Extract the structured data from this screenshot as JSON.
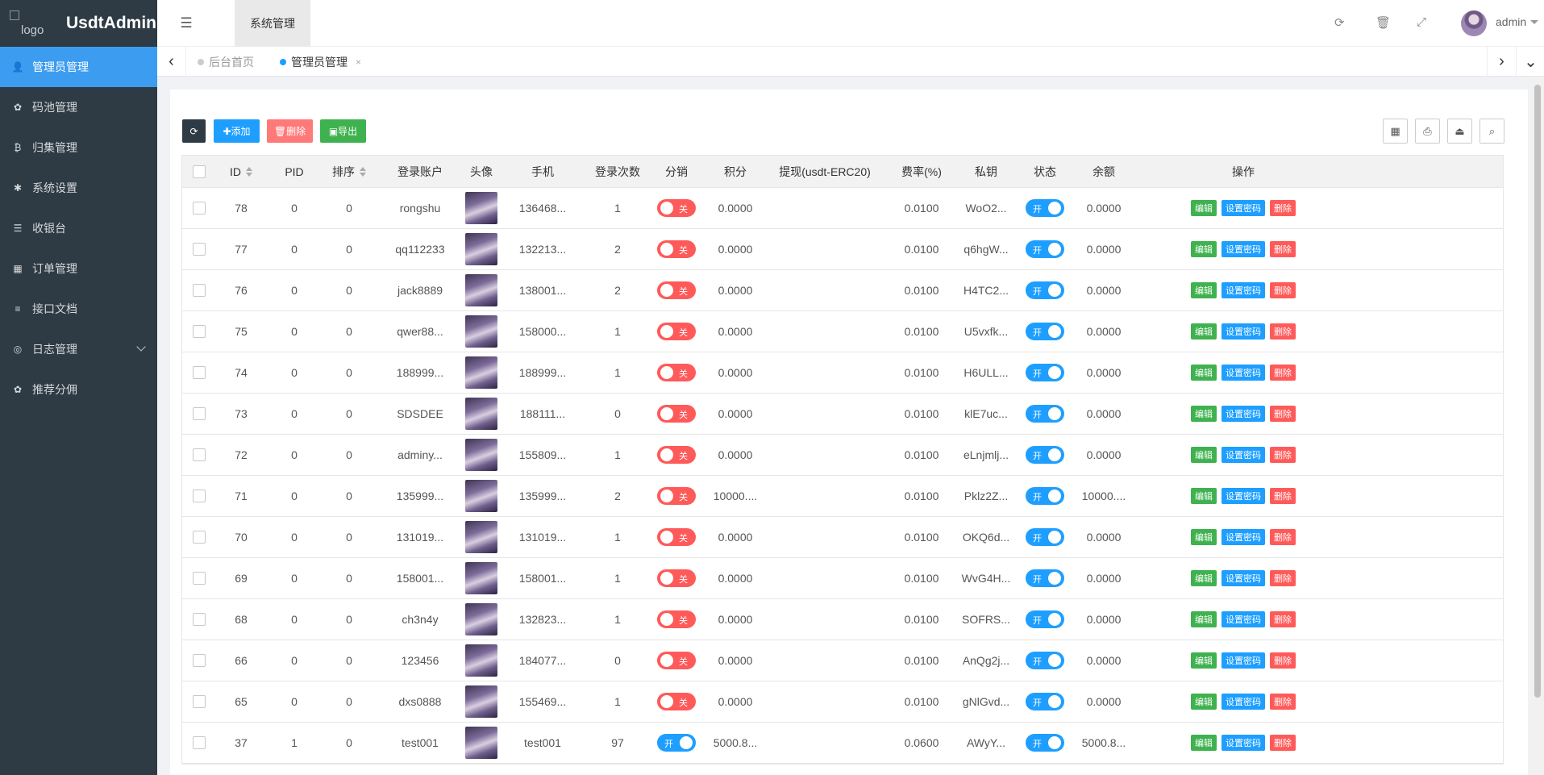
{
  "app": {
    "logo_alt": "logo",
    "name": "UsdtAdmin"
  },
  "sidebar": {
    "items": [
      {
        "label": "管理员管理",
        "icon": "user-icon",
        "glyph": "👤"
      },
      {
        "label": "码池管理",
        "icon": "android-icon",
        "glyph": "✿"
      },
      {
        "label": "归集管理",
        "icon": "bitcoin-icon",
        "glyph": "₿"
      },
      {
        "label": "系统设置",
        "icon": "asterisk-icon",
        "glyph": "✱"
      },
      {
        "label": "收银台",
        "icon": "list-icon",
        "glyph": "☰"
      },
      {
        "label": "订单管理",
        "icon": "calculator-icon",
        "glyph": "▦"
      },
      {
        "label": "接口文档",
        "icon": "align-left-icon",
        "glyph": "≡"
      },
      {
        "label": "日志管理",
        "icon": "dashboard-icon",
        "glyph": "◎"
      },
      {
        "label": "推荐分佣",
        "icon": "android-icon",
        "glyph": "✿"
      }
    ]
  },
  "header": {
    "menu_icon": "☰",
    "section_tab": "系统管理",
    "refresh_icon": "⟳",
    "trash_icon": "🗑",
    "fullscreen_icon": "⤢",
    "user": "admin"
  },
  "tabs": {
    "prev": "‹",
    "next": "›",
    "more": "⌄",
    "items": [
      {
        "label": "后台首页",
        "active": false
      },
      {
        "label": "管理员管理",
        "active": true,
        "close": "×"
      }
    ]
  },
  "toolbar": {
    "refresh": "⟳",
    "add": "✚添加",
    "delete": "🗑删除",
    "export": "▣导出",
    "right_icons": [
      "▦",
      "⎙",
      "⏏",
      "⌕"
    ]
  },
  "table": {
    "columns": [
      "ID",
      "PID",
      "排序",
      "登录账户",
      "头像",
      "手机",
      "登录次数",
      "分销",
      "积分",
      "提现(usdt-ERC20)",
      "费率(%)",
      "私钥",
      "状态",
      "余额",
      "操作"
    ],
    "actions": {
      "edit": "编辑",
      "password": "设置密码",
      "remove": "删除"
    },
    "switch_on": "开",
    "switch_off": "关",
    "rows": [
      {
        "id": "78",
        "pid": "0",
        "sort": "0",
        "account": "rongshu",
        "phone": "136468...",
        "logins": "1",
        "dist": false,
        "points": "0.0000",
        "withdraw": "",
        "rate": "0.0100",
        "key": "WoO2...",
        "status": true,
        "balance": "0.0000"
      },
      {
        "id": "77",
        "pid": "0",
        "sort": "0",
        "account": "qq112233",
        "phone": "132213...",
        "logins": "2",
        "dist": false,
        "points": "0.0000",
        "withdraw": "",
        "rate": "0.0100",
        "key": "q6hgW...",
        "status": true,
        "balance": "0.0000"
      },
      {
        "id": "76",
        "pid": "0",
        "sort": "0",
        "account": "jack8889",
        "phone": "138001...",
        "logins": "2",
        "dist": false,
        "points": "0.0000",
        "withdraw": "",
        "rate": "0.0100",
        "key": "H4TC2...",
        "status": true,
        "balance": "0.0000"
      },
      {
        "id": "75",
        "pid": "0",
        "sort": "0",
        "account": "qwer88...",
        "phone": "158000...",
        "logins": "1",
        "dist": false,
        "points": "0.0000",
        "withdraw": "",
        "rate": "0.0100",
        "key": "U5vxfk...",
        "status": true,
        "balance": "0.0000"
      },
      {
        "id": "74",
        "pid": "0",
        "sort": "0",
        "account": "188999...",
        "phone": "188999...",
        "logins": "1",
        "dist": false,
        "points": "0.0000",
        "withdraw": "",
        "rate": "0.0100",
        "key": "H6ULL...",
        "status": true,
        "balance": "0.0000"
      },
      {
        "id": "73",
        "pid": "0",
        "sort": "0",
        "account": "SDSDEE",
        "phone": "188111...",
        "logins": "0",
        "dist": false,
        "points": "0.0000",
        "withdraw": "",
        "rate": "0.0100",
        "key": "klE7uc...",
        "status": true,
        "balance": "0.0000"
      },
      {
        "id": "72",
        "pid": "0",
        "sort": "0",
        "account": "adminy...",
        "phone": "155809...",
        "logins": "1",
        "dist": false,
        "points": "0.0000",
        "withdraw": "",
        "rate": "0.0100",
        "key": "eLnjmlj...",
        "status": true,
        "balance": "0.0000"
      },
      {
        "id": "71",
        "pid": "0",
        "sort": "0",
        "account": "135999...",
        "phone": "135999...",
        "logins": "2",
        "dist": false,
        "points": "10000....",
        "withdraw": "",
        "rate": "0.0100",
        "key": "Pklz2Z...",
        "status": true,
        "balance": "10000...."
      },
      {
        "id": "70",
        "pid": "0",
        "sort": "0",
        "account": "131019...",
        "phone": "131019...",
        "logins": "1",
        "dist": false,
        "points": "0.0000",
        "withdraw": "",
        "rate": "0.0100",
        "key": "OKQ6d...",
        "status": true,
        "balance": "0.0000"
      },
      {
        "id": "69",
        "pid": "0",
        "sort": "0",
        "account": "158001...",
        "phone": "158001...",
        "logins": "1",
        "dist": false,
        "points": "0.0000",
        "withdraw": "",
        "rate": "0.0100",
        "key": "WvG4H...",
        "status": true,
        "balance": "0.0000"
      },
      {
        "id": "68",
        "pid": "0",
        "sort": "0",
        "account": "ch3n4y",
        "phone": "132823...",
        "logins": "1",
        "dist": false,
        "points": "0.0000",
        "withdraw": "",
        "rate": "0.0100",
        "key": "SOFRS...",
        "status": true,
        "balance": "0.0000"
      },
      {
        "id": "66",
        "pid": "0",
        "sort": "0",
        "account": "123456",
        "phone": "184077...",
        "logins": "0",
        "dist": false,
        "points": "0.0000",
        "withdraw": "",
        "rate": "0.0100",
        "key": "AnQg2j...",
        "status": true,
        "balance": "0.0000"
      },
      {
        "id": "65",
        "pid": "0",
        "sort": "0",
        "account": "dxs0888",
        "phone": "155469...",
        "logins": "1",
        "dist": false,
        "points": "0.0000",
        "withdraw": "",
        "rate": "0.0100",
        "key": "gNlGvd...",
        "status": true,
        "balance": "0.0000"
      },
      {
        "id": "37",
        "pid": "1",
        "sort": "0",
        "account": "test001",
        "phone": "test001",
        "logins": "97",
        "dist": true,
        "points": "5000.8...",
        "withdraw": "",
        "rate": "0.0600",
        "key": "AWyY...",
        "status": true,
        "balance": "5000.8..."
      }
    ]
  },
  "colors": {
    "sidebar_bg": "#2f3b44",
    "active_blue": "#3c9cf0",
    "primary": "#1e9fff",
    "danger": "#ff5a5a",
    "success": "#3fb24f"
  }
}
